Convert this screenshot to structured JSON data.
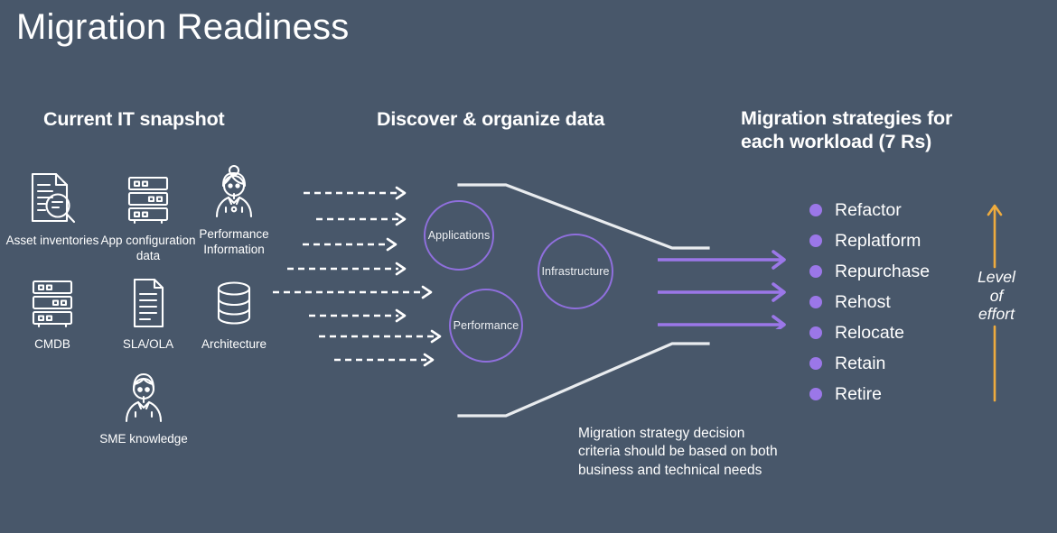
{
  "title": "Migration Readiness",
  "colors": {
    "background": "#48576a",
    "accent_purple": "#9b77e8",
    "circle_purple": "#8f6fdd",
    "effort_orange": "#eeab3e",
    "text": "#ffffff"
  },
  "columns": {
    "current": {
      "heading": "Current IT snapshot",
      "items": [
        {
          "icon": "document-search-icon",
          "label": "Asset inventories"
        },
        {
          "icon": "server-rack-icon",
          "label": "App configuration data"
        },
        {
          "icon": "person-headset-icon",
          "label": "Performance Information"
        },
        {
          "icon": "server-rack-icon",
          "label": "CMDB"
        },
        {
          "icon": "document-icon",
          "label": "SLA/OLA"
        },
        {
          "icon": "database-icon",
          "label": "Architecture"
        },
        {
          "icon": "person-icon",
          "label": "SME knowledge"
        }
      ]
    },
    "discover": {
      "heading": "Discover & organize data",
      "bubbles": [
        {
          "label": "Applications"
        },
        {
          "label": "Infrastructure"
        },
        {
          "label": "Performance"
        }
      ],
      "dashed_arrow_count": 8
    },
    "strategies": {
      "heading_line1": "Migration strategies for",
      "heading_line2": "each workload (7 Rs)",
      "items": [
        {
          "label": "Refactor"
        },
        {
          "label": "Replatform"
        },
        {
          "label": "Repurchase"
        },
        {
          "label": "Rehost"
        },
        {
          "label": "Relocate"
        },
        {
          "label": "Retain"
        },
        {
          "label": "Retire"
        }
      ],
      "effort_line1": "Level",
      "effort_line2": "of",
      "effort_line3": "effort",
      "funnel_arrow_count": 3
    }
  },
  "caption": {
    "line1": "Migration strategy decision",
    "line2": "criteria should be based on both",
    "line3": "business and technical needs"
  }
}
